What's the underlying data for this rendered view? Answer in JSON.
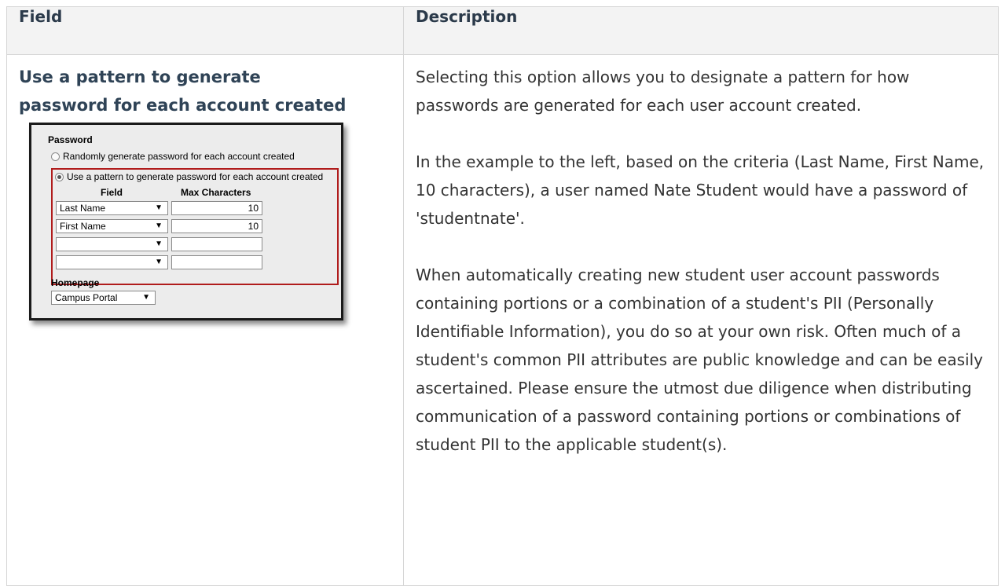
{
  "table": {
    "headers": [
      "Field",
      "Description"
    ],
    "field_title": "Use a pattern to generate password for each account created",
    "description_paragraphs": [
      "Selecting this option allows you to designate a pattern for how passwords are generated for each user account created.",
      "In the example to the left, based on the criteria (Last Name, First Name, 10 characters), a user named Nate Student would have a password of 'studentnate'.",
      "When automatically creating new student user account passwords containing portions or a combination of a student's PII (Personally Identifiable Information), you do so at your own risk. Often much of a student's common PII attributes are public knowledge and can be easily ascertained. Please ensure the utmost due diligence when distributing communication of a password containing portions or combinations of student PII to the applicable student(s)."
    ]
  },
  "example": {
    "password_label": "Password",
    "option_random": "Randomly generate password for each account created",
    "option_pattern": "Use a pattern to generate password for each account created",
    "selected_option": "pattern",
    "col_field": "Field",
    "col_max": "Max Characters",
    "rows": [
      {
        "field": "Last Name",
        "max": "10"
      },
      {
        "field": "First Name",
        "max": "10"
      },
      {
        "field": "",
        "max": ""
      },
      {
        "field": "",
        "max": ""
      }
    ],
    "dropdown_arrow": "▼",
    "homepage_label": "Homepage",
    "homepage_value": "Campus Portal"
  },
  "colors": {
    "header_bg": "#f3f3f3",
    "border": "#d6d6d6",
    "title": "#2f4356",
    "highlight": "#b01c1c"
  }
}
